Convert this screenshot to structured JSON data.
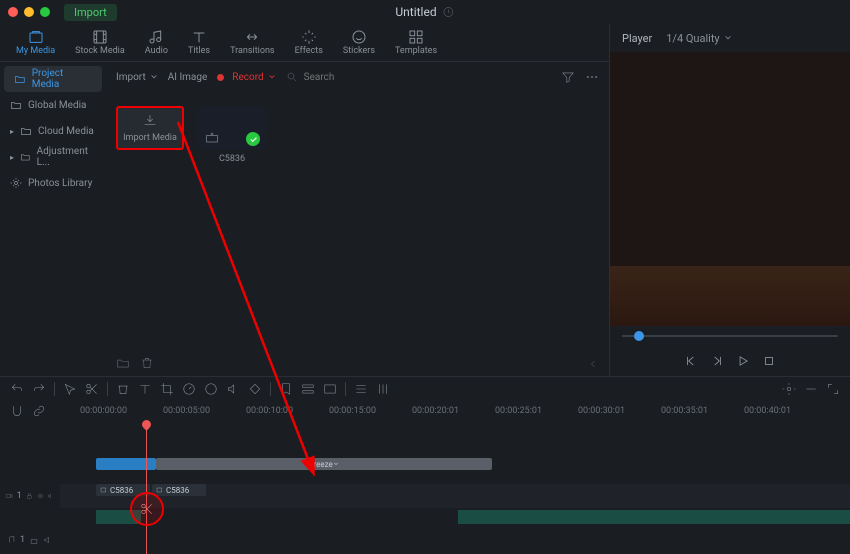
{
  "titlebar": {
    "import_label": "Import",
    "doc_title": "Untitled"
  },
  "toolbar": [
    {
      "label": "My Media",
      "name": "tab-my-media"
    },
    {
      "label": "Stock Media",
      "name": "tab-stock-media"
    },
    {
      "label": "Audio",
      "name": "tab-audio"
    },
    {
      "label": "Titles",
      "name": "tab-titles"
    },
    {
      "label": "Transitions",
      "name": "tab-transitions"
    },
    {
      "label": "Effects",
      "name": "tab-effects"
    },
    {
      "label": "Stickers",
      "name": "tab-stickers"
    },
    {
      "label": "Templates",
      "name": "tab-templates"
    }
  ],
  "sidebar": {
    "items": [
      {
        "label": "Project Media",
        "name": "sidebar-project-media"
      },
      {
        "label": "Global Media",
        "name": "sidebar-global-media"
      },
      {
        "label": "Cloud Media",
        "name": "sidebar-cloud-media"
      },
      {
        "label": "Adjustment L...",
        "name": "sidebar-adjustment-layer"
      },
      {
        "label": "Photos Library",
        "name": "sidebar-photos-library"
      }
    ]
  },
  "media_bar": {
    "import_label": "Import",
    "ai_image_label": "AI Image",
    "record_label": "Record",
    "search_placeholder": "Search"
  },
  "thumbs": {
    "import_tile": "Import Media",
    "clip_name": "C5836"
  },
  "player": {
    "label": "Player",
    "quality": "1/4 Quality"
  },
  "ruler_ticks": [
    "00:00:00:00",
    "00:00:05:00",
    "00:00:10:00",
    "00:00:15:00",
    "00:00:20:01",
    "00:00:25:01",
    "00:00:30:01",
    "00:00:35:01",
    "00:00:40:01"
  ],
  "tracks": {
    "freeze_label": "Freeze",
    "clip_label": "C5836",
    "video_track_badge": "1",
    "audio_track_badge": "1"
  }
}
